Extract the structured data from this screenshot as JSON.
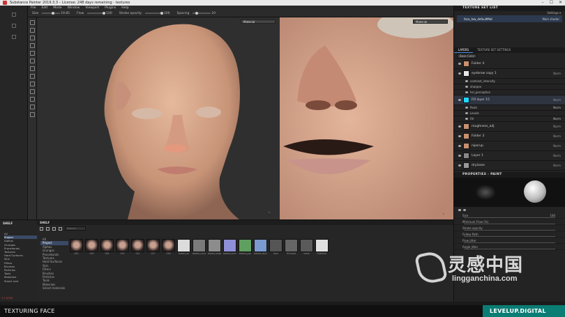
{
  "window": {
    "title": "Substance Painter 2019.3.3 – License: 248 days remaining - textures",
    "controls": [
      "–",
      "☐",
      "✕"
    ]
  },
  "menu": [
    "File",
    "Edit",
    "Mode",
    "Window",
    "Viewport",
    "Plugins",
    "Help"
  ],
  "toolbar": {
    "size_label": "Size",
    "size_value": "19.85",
    "flow_label": "Flow",
    "flow_value": "100",
    "stroke_opacity_label": "Stroke opacity",
    "stroke_opacity_value": "100",
    "spacing_label": "Spacing",
    "spacing_value": "10"
  },
  "viewport": {
    "material_3d": "Material",
    "material_2d": "Material"
  },
  "texture_set_list": {
    "title": "TEXTURE SET LIST",
    "settings": "Settings ▾",
    "item": "face_low_defaultMat",
    "shader": "Main shader"
  },
  "layers": {
    "tab_layers": "LAYERS",
    "tab_settings": "TEXTURE SET SETTINGS",
    "channel": "Base Color",
    "items": [
      {
        "name": "Folder 4",
        "blend": "",
        "color": "#c8906e"
      },
      {
        "name": "eyebrow copy 1",
        "blend": "Norm",
        "color": "#e8e8e8"
      },
      {
        "name": "roughness_adj",
        "blend": "Norm",
        "color": "#c8906e"
      },
      {
        "name": "Folder 3",
        "blend": "Norm",
        "color": "#c8906e"
      },
      {
        "name": "nipsrup",
        "blend": "Norm",
        "color": "#c8906e"
      },
      {
        "name": "Layer 1",
        "blend": "Norm",
        "color": "#888888"
      },
      {
        "name": "dry.base",
        "blend": "Norm",
        "color": "#999999"
      }
    ],
    "sub_a": [
      {
        "name": "contrast_intensity"
      },
      {
        "name": "sharpen"
      },
      {
        "name": "hsl_perceptive"
      }
    ],
    "fill_layer": {
      "name": "Fill layer 15",
      "blend": "Norm"
    },
    "sub_b": [
      {
        "name": "Paint",
        "blend": "Norm"
      },
      {
        "name": "Levels",
        "blend": ""
      },
      {
        "name": "Fill",
        "blend": "Norm"
      }
    ]
  },
  "properties": {
    "title": "PROPERTIES - PAINT",
    "rows": [
      "Size",
      "Minimum Flow (%)",
      "Stroke opacity",
      "Follow Path",
      "Flow jitter",
      "Angle jitter"
    ],
    "size_value": "100"
  },
  "shelf": {
    "title": "SHELF",
    "search_placeholder": "Search...",
    "left_title": "SHELF",
    "left_categories": [
      "All",
      "Project",
      "Alphas",
      "Grunges",
      "Procedurals",
      "Textures",
      "Hard Surfaces",
      "Skin",
      "Filters",
      "Brushes",
      "Particles",
      "Tools",
      "Materials",
      "Smart mat"
    ],
    "categories": [
      "All",
      "Project",
      "Alphas",
      "Grunges",
      "Procedurals",
      "Textures",
      "Hard Surfaces",
      "Skin",
      "Filters",
      "Brushes",
      "Particles",
      "Tools",
      "Materials",
      "Smart materials"
    ],
    "assets": [
      {
        "label": "002",
        "color": "#5a4034"
      },
      {
        "label": "003",
        "color": "#5a4034"
      },
      {
        "label": "004",
        "color": "#5a4034"
      },
      {
        "label": "010",
        "color": "#5a4034"
      },
      {
        "label": "011",
        "color": "#5a4034"
      },
      {
        "label": "017",
        "color": "#5a4034"
      },
      {
        "label": "018",
        "color": "#5a4034"
      },
      {
        "label": "baked_ao",
        "color": "#dcdcdc"
      },
      {
        "label": "baked_curve",
        "color": "#7a7a7a"
      },
      {
        "label": "baked_height",
        "color": "#8c8c8c"
      },
      {
        "label": "baked_normal",
        "color": "#8f8fd8"
      },
      {
        "label": "baked_pos",
        "color": "#5fa060"
      },
      {
        "label": "baked_wsnl",
        "color": "#7a9ad0"
      },
      {
        "label": "face",
        "color": "#555555"
      },
      {
        "label": "fill-head",
        "color": "#666666"
      },
      {
        "label": "mask",
        "color": "#5a5a5a"
      },
      {
        "label": "Flattener",
        "color": "#e0e0e0"
      }
    ]
  },
  "footer": {
    "course": "TEXTURING FACE",
    "brand": "LEVELUP.DIGITAL"
  },
  "watermark": {
    "cn": "灵感中国",
    "url": "lingganchina.com"
  },
  "status": {
    "version": "1.5 (02B)"
  }
}
